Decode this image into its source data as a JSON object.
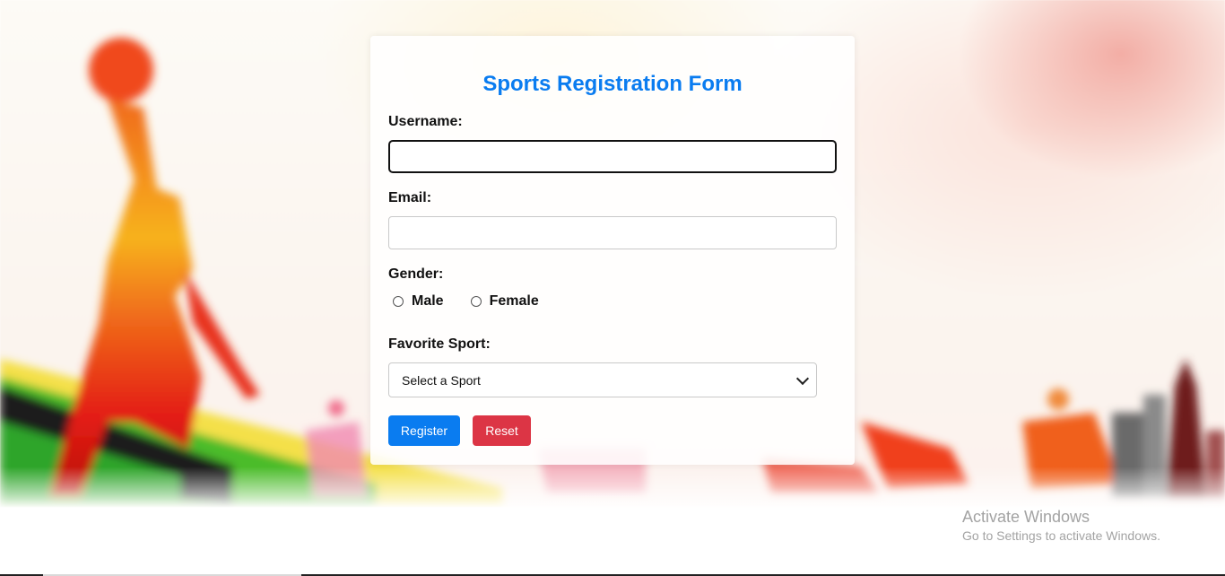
{
  "form": {
    "title": "Sports Registration Form",
    "username_label": "Username:",
    "username_value": "",
    "email_label": "Email:",
    "email_value": "",
    "gender_label": "Gender:",
    "gender_options": [
      "Male",
      "Female"
    ],
    "sport_label": "Favorite Sport:",
    "sport_selected": "Select a Sport",
    "register_label": "Register",
    "reset_label": "Reset"
  },
  "watermark": {
    "title": "Activate Windows",
    "subtitle": "Go to Settings to activate Windows."
  },
  "colors": {
    "title": "#0a7cf0",
    "register": "#0a7cf0",
    "reset": "#dc3545"
  }
}
